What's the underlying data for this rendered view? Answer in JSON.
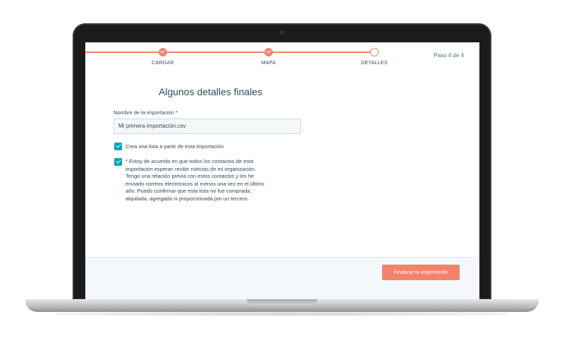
{
  "stepper": {
    "steps": [
      {
        "label": "CARGAR",
        "state": "done"
      },
      {
        "label": "MAPA",
        "state": "done"
      },
      {
        "label": "DETALLES",
        "state": "current"
      }
    ],
    "counter": "Paso 4 de 4"
  },
  "form": {
    "title": "Algunos detalles finales",
    "import_name_label": "Nombre de la importación *",
    "import_name_value": "Mi primera importación.csv",
    "create_list_label": "Crea una lista a partir de esta importación",
    "consent_lines": [
      "* Estoy de acuerdo en que todos los contactos de esta",
      "importación esperan recibir noticias de mi organización.",
      "Tengo una relación previa con estos contactos y les he",
      "enviado correos electrónicos al menos una vez en el último",
      "año. Puedo confirmar que esta lista no fue comprada,",
      "alquilada, agregada ni proporcionada por un tercero."
    ]
  },
  "footer": {
    "finish_label": "Finalizar la importación"
  },
  "colors": {
    "accent": "#f2836b",
    "checkbox": "#00a4bd",
    "text": "#33475b"
  }
}
